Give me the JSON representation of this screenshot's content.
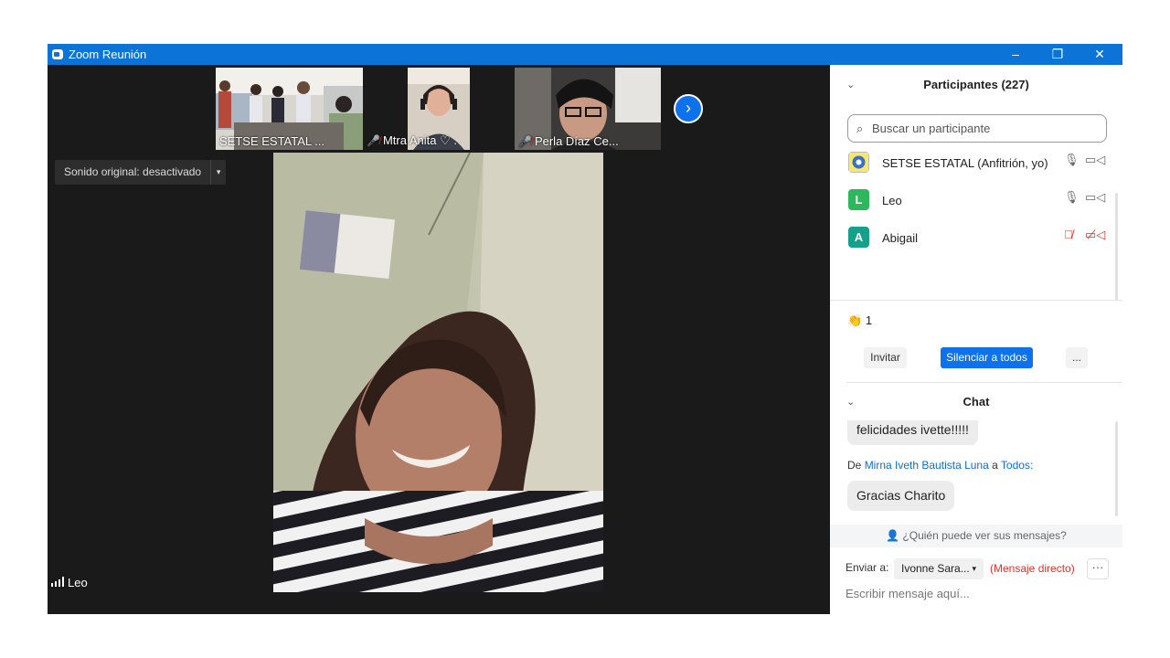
{
  "window": {
    "title": "Zoom Reunión",
    "minimize": "–",
    "restore": "❐",
    "close": "✕"
  },
  "strip": {
    "thumbs": [
      {
        "name": "SETSE ESTATAL ..."
      },
      {
        "name": "Mtra Anita ♡ ."
      },
      {
        "name": "Perla Díaz Ce..."
      }
    ],
    "next_icon": "›"
  },
  "sound_toggle": {
    "label": "Sonido original: desactivado",
    "caret": "▾"
  },
  "speaker": {
    "name": "Leo"
  },
  "participants": {
    "header": "Participantes (227)",
    "search_placeholder": "Buscar un participante",
    "items": [
      {
        "name": "SETSE ESTATAL (Anfitrión, yo)",
        "initial": "",
        "muted": false
      },
      {
        "name": "Leo",
        "initial": "L",
        "color": "#2eb85c",
        "muted": false
      },
      {
        "name": "Abigail",
        "initial": "A",
        "color": "#16a08a",
        "muted": true
      }
    ],
    "reaction_count": "1",
    "invite_label": "Invitar",
    "mute_all_label": "Silenciar a todos",
    "more_label": "..."
  },
  "chat": {
    "header": "Chat",
    "messages": [
      {
        "text": "felicidades ivette!!!!!"
      },
      {
        "from_prefix": "De",
        "sender": "Mirna Iveth Bautista Luna",
        "to_prefix": "a",
        "recipient": "Todos:",
        "text": "Gracias Charito"
      }
    ],
    "who_can_see": "¿Quién puede ver sus mensajes?",
    "send_to_label": "Enviar a:",
    "send_to_value": "Ivonne Sara...",
    "direct_label": "(Mensaje directo)",
    "more_label": "···",
    "compose_placeholder": "Escribir mensaje aquí..."
  }
}
